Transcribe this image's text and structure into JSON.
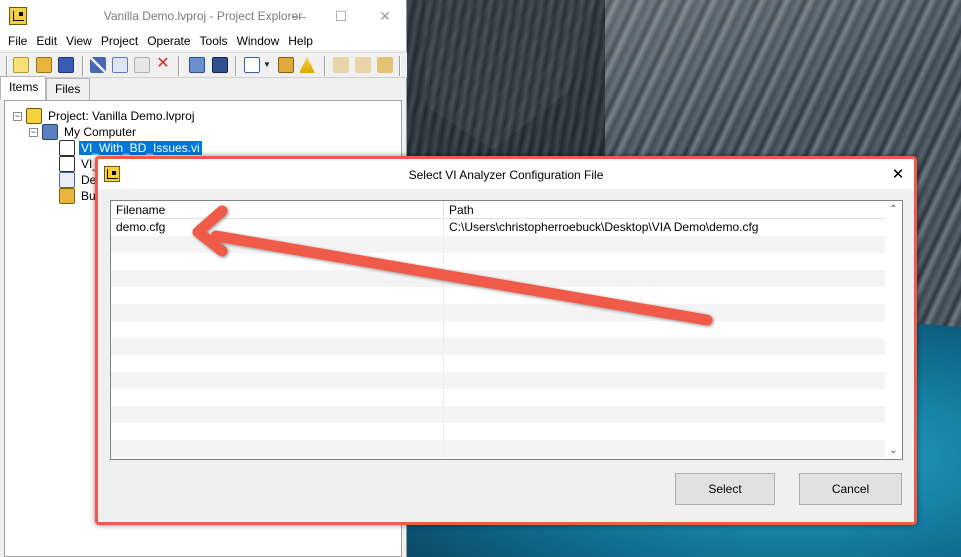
{
  "project_explorer": {
    "title": "Vanilla Demo.lvproj - Project Explorer",
    "window_controls": {
      "minimize": "—",
      "maximize": "☐",
      "close": "✕"
    },
    "menu": [
      "File",
      "Edit",
      "View",
      "Project",
      "Operate",
      "Tools",
      "Window",
      "Help"
    ],
    "tabs": [
      "Items",
      "Files"
    ],
    "tree": {
      "project": "Project: Vanilla Demo.lvproj",
      "computer": "My Computer",
      "items": [
        "VI_With_BD_Issues.vi",
        "VI_",
        "De",
        "Bu"
      ]
    }
  },
  "dialog": {
    "title": "Select VI Analyzer Configuration File",
    "close": "✕",
    "columns": {
      "filename": "Filename",
      "path": "Path"
    },
    "rows": [
      {
        "filename": "demo.cfg",
        "path": "C:\\Users\\christopherroebuck\\Desktop\\VIA Demo\\demo.cfg"
      }
    ],
    "empty_row_count": 13,
    "scroll_up": "⌃",
    "scroll_down": "⌄",
    "buttons": {
      "select": "Select",
      "cancel": "Cancel"
    }
  },
  "colors": {
    "selection": "#0078d7",
    "annotation": "#f05a4a",
    "app_icon": "#f4d03f"
  }
}
